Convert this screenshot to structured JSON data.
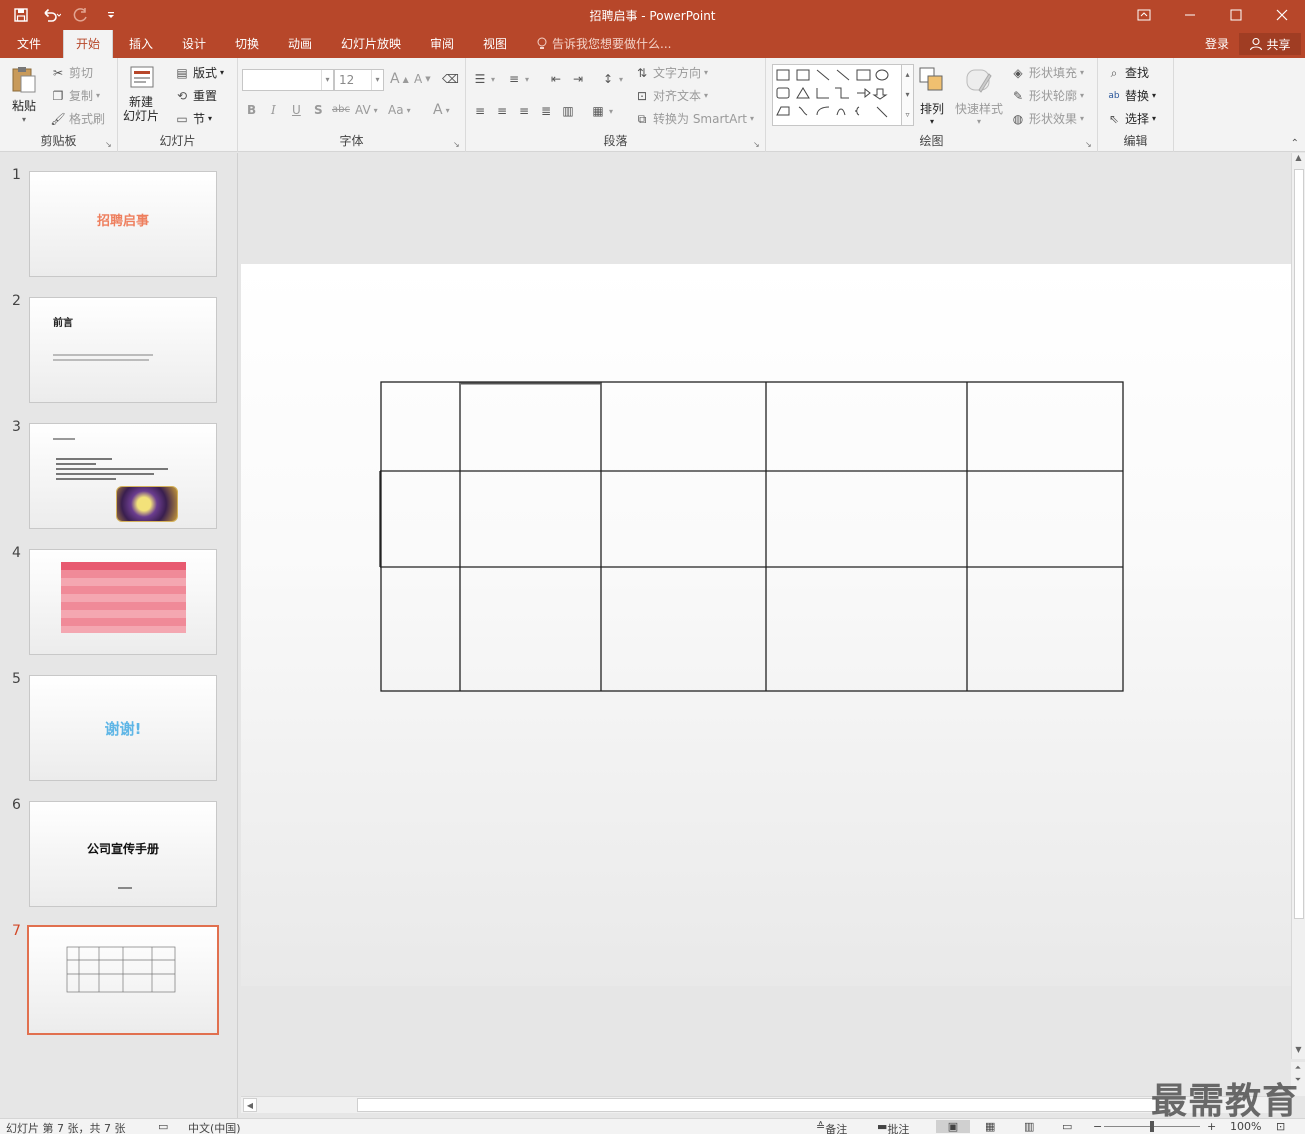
{
  "titlebar": {
    "title": "招聘启事 - PowerPoint"
  },
  "tabs": {
    "file": "文件",
    "home": "开始",
    "insert": "插入",
    "design": "设计",
    "transitions": "切换",
    "animations": "动画",
    "slideshow": "幻灯片放映",
    "review": "审阅",
    "view": "视图",
    "tellme": "告诉我您想要做什么...",
    "login": "登录",
    "share": "共享"
  },
  "ribbon": {
    "clipboard": {
      "label": "剪贴板",
      "paste": "粘贴",
      "cut": "剪切",
      "copy": "复制",
      "format_painter": "格式刷"
    },
    "slides": {
      "label": "幻灯片",
      "new_slide_1": "新建",
      "new_slide_2": "幻灯片",
      "layout": "版式",
      "reset": "重置",
      "section": "节"
    },
    "font": {
      "label": "字体",
      "font_size": "12",
      "bold": "B",
      "italic": "I",
      "underline": "U",
      "shadow": "S",
      "strike": "abc",
      "spacing": "AV",
      "case": "Aa",
      "color": "A",
      "grow": "A",
      "shrink": "A"
    },
    "paragraph": {
      "label": "段落",
      "text_direction": "文字方向",
      "align_text": "对齐文本",
      "smartart": "转换为 SmartArt"
    },
    "drawing": {
      "label": "绘图",
      "arrange": "排列",
      "quick_styles": "快速样式",
      "shape_fill": "形状填充",
      "shape_outline": "形状轮廓",
      "shape_effects": "形状效果"
    },
    "editing": {
      "label": "编辑",
      "find": "查找",
      "replace": "替换",
      "select": "选择"
    }
  },
  "slides": [
    {
      "num": "1",
      "title": "招聘启事"
    },
    {
      "num": "2",
      "title": "前言"
    },
    {
      "num": "3",
      "title": ""
    },
    {
      "num": "4",
      "title": ""
    },
    {
      "num": "5",
      "title": "谢谢!"
    },
    {
      "num": "6",
      "title": "公司宣传手册"
    },
    {
      "num": "7",
      "title": ""
    }
  ],
  "status": {
    "slide_info": "幻灯片 第 7 张，共 7 张",
    "language": "中文(中国)",
    "notes": "备注",
    "comments": "批注",
    "zoom": "100%"
  },
  "watermark": "最需教育",
  "colors": {
    "accent": "#b7472a",
    "selected_thumb": "#e1704f"
  }
}
